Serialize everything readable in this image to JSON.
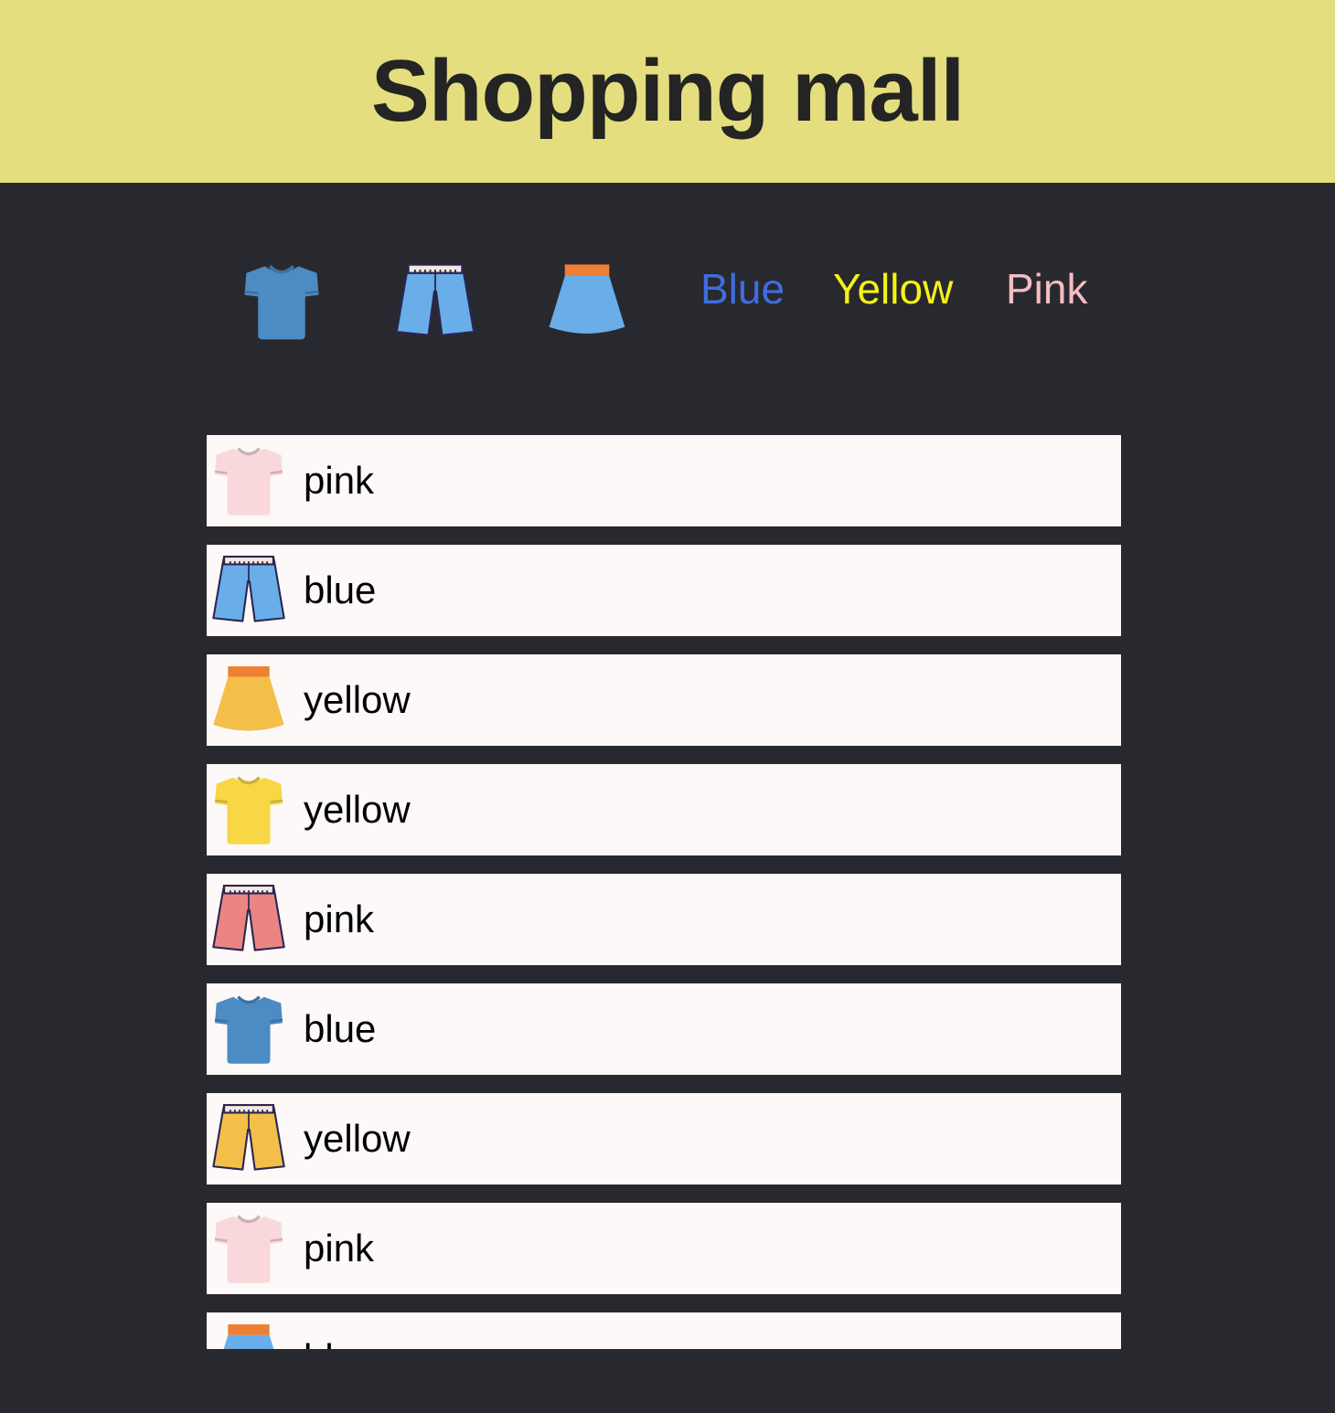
{
  "header": {
    "title": "Shopping mall"
  },
  "filters": {
    "icons": [
      {
        "name": "tshirt-icon",
        "color": "#4c8bc4"
      },
      {
        "name": "pants-icon",
        "color": "#69ade9"
      },
      {
        "name": "skirt-icon",
        "color": "#69ade9"
      }
    ],
    "colors": [
      {
        "label": "Blue",
        "color": "#3e6de0"
      },
      {
        "label": "Yellow",
        "color": "#f6f218"
      },
      {
        "label": "Pink",
        "color": "#f4bdc2"
      }
    ]
  },
  "items": [
    {
      "type": "tshirt",
      "color": "#f9d8dc",
      "label": "pink"
    },
    {
      "type": "pants",
      "color": "#69ade9",
      "label": "blue"
    },
    {
      "type": "skirt",
      "color": "#f3bf48",
      "label": "yellow"
    },
    {
      "type": "tshirt",
      "color": "#f8d646",
      "label": "yellow"
    },
    {
      "type": "pants",
      "color": "#ea8584",
      "label": "pink"
    },
    {
      "type": "tshirt",
      "color": "#4c8bc4",
      "label": "blue"
    },
    {
      "type": "pants",
      "color": "#f3bf48",
      "label": "yellow"
    },
    {
      "type": "tshirt",
      "color": "#f9d8dc",
      "label": "pink"
    },
    {
      "type": "skirt",
      "color": "#69ade9",
      "label": "blue"
    }
  ]
}
